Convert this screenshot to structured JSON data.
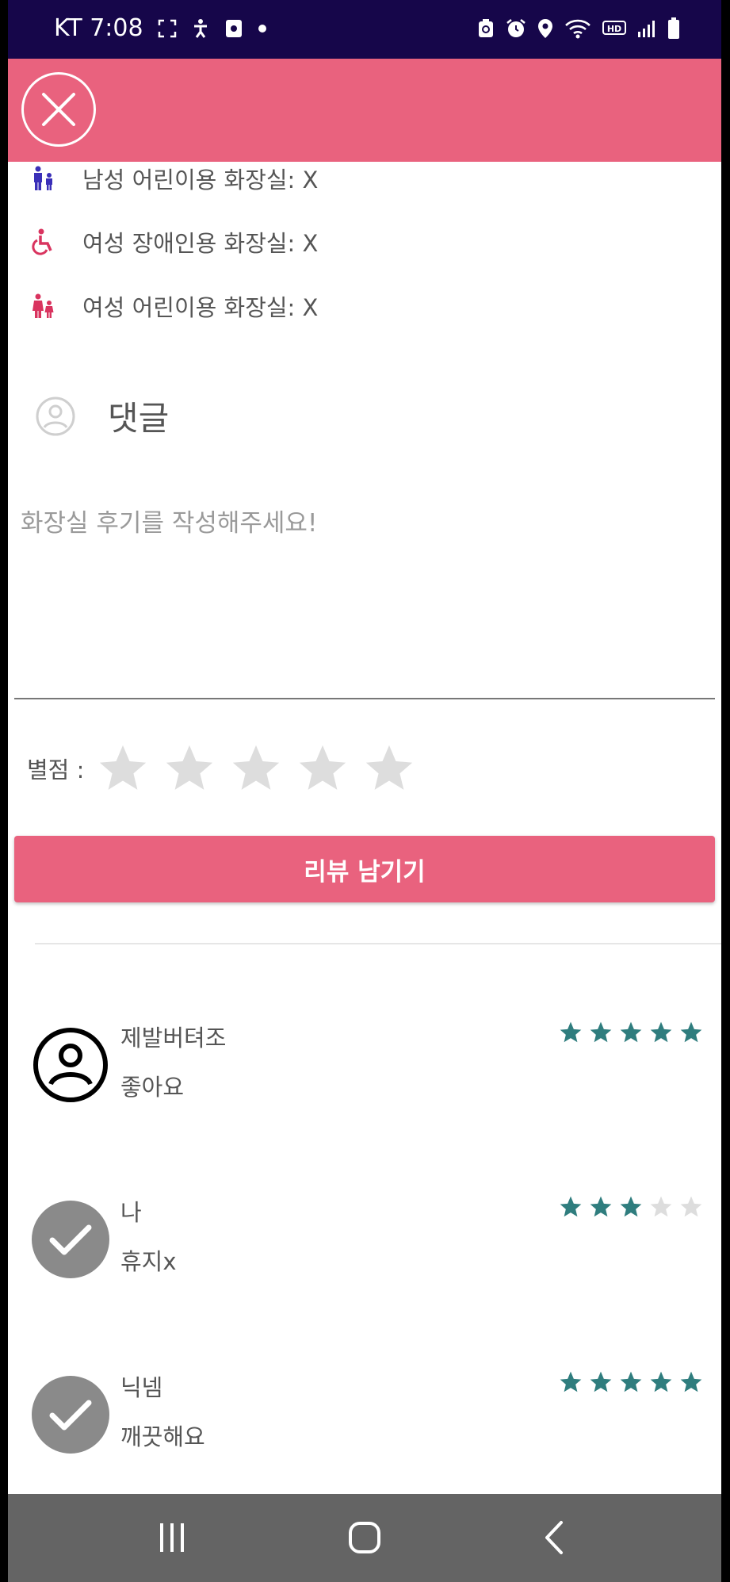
{
  "status_bar": {
    "carrier_time": "KT 7:08",
    "icons_left": [
      "screenshot-icon",
      "accessibility-icon",
      "media-icon",
      "dot-icon"
    ],
    "icons_right": [
      "recycle-icon",
      "alarm-icon",
      "location-icon",
      "wifi-icon",
      "hd-icon",
      "signal-icon",
      "battery-icon"
    ]
  },
  "app_bar": {
    "close_icon": "close-icon",
    "color": "#e9627e"
  },
  "facilities": [
    {
      "icon": "male-child-toilet-icon",
      "label": "남성 어린이용 화장실: X",
      "color": "#3a2fb8"
    },
    {
      "icon": "wheelchair-icon",
      "label": "여성 장애인용 화장실: X",
      "color": "#d9345f"
    },
    {
      "icon": "female-child-toilet-icon",
      "label": "여성 어린이용 화장실: X",
      "color": "#d9345f"
    }
  ],
  "comment_section": {
    "title": "댓글",
    "icon": "user-circle-icon",
    "input_placeholder": "화장실 후기를 작성해주세요!",
    "input_value": "",
    "rating_label": "별점 :",
    "rating_value": 0,
    "rating_max": 5,
    "submit_label": "리뷰 남기기"
  },
  "reviews": [
    {
      "avatar": "person-outline-icon",
      "name": "제발버텨조",
      "text": "좋아요",
      "rating": 5
    },
    {
      "avatar": "check-circle-icon",
      "name": "나",
      "text": "휴지x",
      "rating": 3
    },
    {
      "avatar": "check-circle-icon",
      "name": "닉넴",
      "text": "깨끗해요",
      "rating": 5
    }
  ],
  "colors": {
    "accent": "#e9627e",
    "star_filled": "#2f7d7e",
    "star_empty": "#dddddd",
    "status_bar": "#16064a",
    "nav_bar": "#646464"
  },
  "nav_bar": {
    "buttons": [
      "recent-apps-icon",
      "home-icon",
      "back-icon"
    ]
  }
}
